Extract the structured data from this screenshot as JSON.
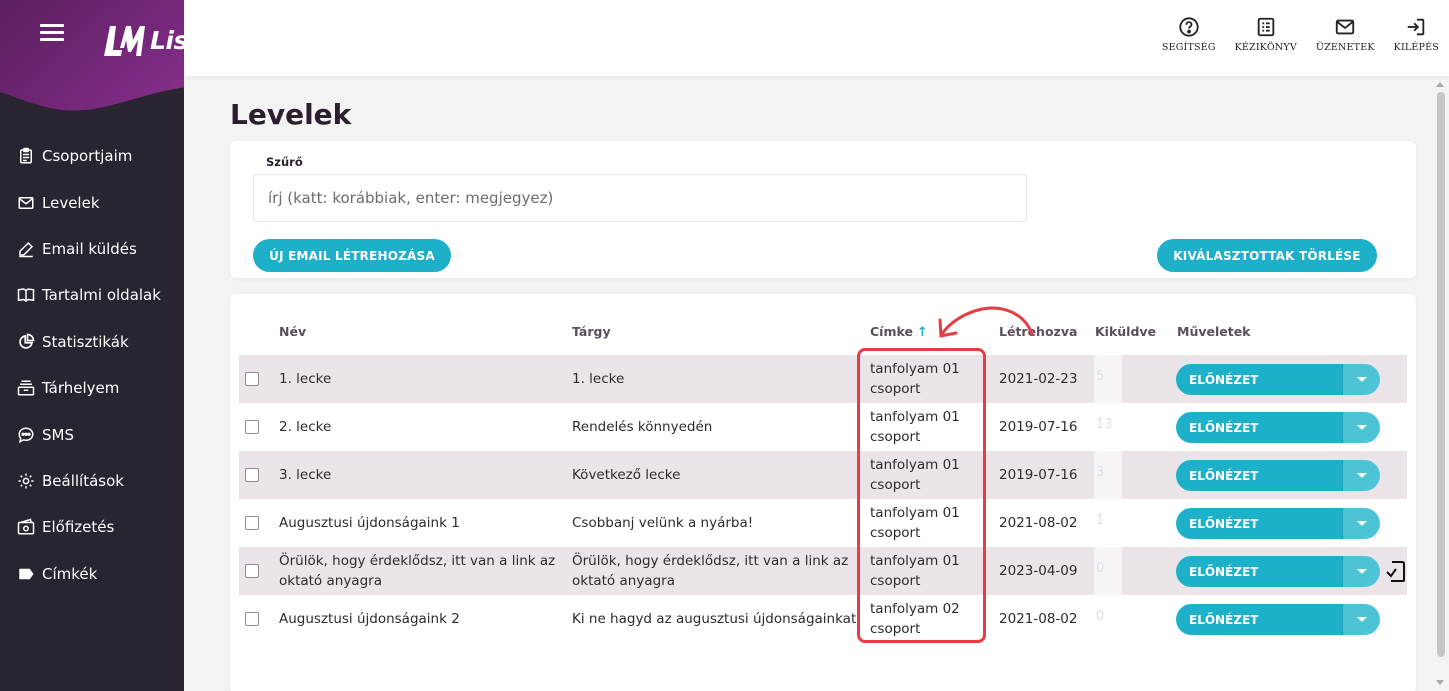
{
  "app": {
    "name": "ListaMester"
  },
  "colors": {
    "sidebar": "#2a2330",
    "accent": "#1eb0c9",
    "brand_purple": "#8a2d8c",
    "highlight": "#e63d45",
    "row_alt": "#ebe4e8"
  },
  "sidebar": {
    "items": [
      {
        "label": "Csoportjaim",
        "icon": "clipboard-icon"
      },
      {
        "label": "Levelek",
        "icon": "envelope-icon"
      },
      {
        "label": "Email küldés",
        "icon": "pencil-icon"
      },
      {
        "label": "Tartalmi oldalak",
        "icon": "book-icon"
      },
      {
        "label": "Statisztikák",
        "icon": "pie-chart-icon"
      },
      {
        "label": "Tárhelyem",
        "icon": "storage-icon"
      },
      {
        "label": "SMS",
        "icon": "chat-icon"
      },
      {
        "label": "Beállítások",
        "icon": "gear-icon"
      },
      {
        "label": "Előfizetés",
        "icon": "wallet-icon"
      },
      {
        "label": "Címkék",
        "icon": "tag-icon"
      }
    ]
  },
  "topbar": {
    "help": "SEGÍTSÉG",
    "manual": "KÉZIKÖNYV",
    "messages": "ÜZENETEK",
    "logout": "KILÉPÉS"
  },
  "page": {
    "title": "Levelek"
  },
  "filter": {
    "label": "Szűrő",
    "placeholder": "írj (katt: korábbiak, enter: megjegyez)",
    "new_button": "ÚJ EMAIL LÉTREHOZÁSA",
    "delete_button": "KIVÁLASZTOTTAK TÖRLÉSE"
  },
  "table": {
    "headers": {
      "name": "Név",
      "subject": "Tárgy",
      "tag": "Címke",
      "tag_sort": "↑",
      "created": "Létrehozva",
      "sent": "Kiküldve",
      "actions": "Műveletek"
    },
    "preview_label": "ELŐNÉZET",
    "rows": [
      {
        "name": "1. lecke",
        "subject": "1. lecke",
        "tag": "tanfolyam 01 csoport",
        "created": "2021-02-23",
        "sent": "5"
      },
      {
        "name": "2. lecke",
        "subject": "Rendelés könnyedén",
        "tag": "tanfolyam 01 csoport",
        "created": "2019-07-16",
        "sent": "13"
      },
      {
        "name": "3. lecke",
        "subject": "Következő lecke",
        "tag": "tanfolyam 01 csoport",
        "created": "2019-07-16",
        "sent": "3"
      },
      {
        "name": "Augusztusi újdonságaink 1",
        "subject": "Csobbanj velünk a nyárba!",
        "tag": "tanfolyam 01 csoport",
        "created": "2021-08-02",
        "sent": "1"
      },
      {
        "name": "Örülök, hogy érdeklődsz, itt van a link az oktató anyagra",
        "subject": "Örülök, hogy érdeklődsz, itt van a link az oktató anyagra",
        "tag": "tanfolyam 01 csoport",
        "created": "2023-04-09",
        "sent": "0"
      },
      {
        "name": "Augusztusi újdonságaink 2",
        "subject": "Ki ne hagyd az augusztusi újdonságainkat",
        "tag": "tanfolyam 02 csoport",
        "created": "2021-08-02",
        "sent": "0"
      }
    ]
  }
}
